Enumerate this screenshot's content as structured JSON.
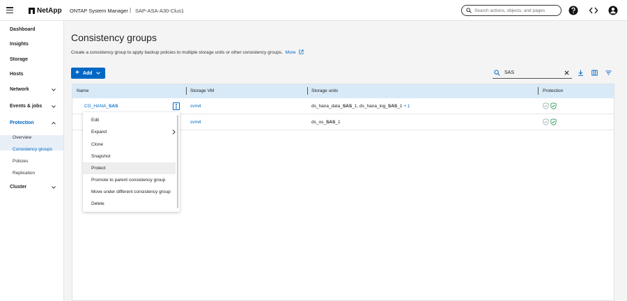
{
  "topbar": {
    "brand": "NetApp",
    "product": "ONTAP System Manager",
    "separator": "|",
    "cluster": "SAP-ASA-A30-Clus1",
    "search_placeholder": "Search actions, objects, and pages",
    "icons": [
      "menu-icon",
      "search-icon",
      "help-icon",
      "code-icon",
      "user-icon"
    ]
  },
  "sidebar": {
    "items": [
      {
        "label": "Dashboard"
      },
      {
        "label": "Insights"
      },
      {
        "label": "Storage"
      },
      {
        "label": "Hosts"
      },
      {
        "label": "Network"
      },
      {
        "label": "Events & jobs"
      },
      {
        "label": "Protection"
      },
      {
        "label": "Cluster"
      }
    ],
    "protection_sub": [
      {
        "label": "Overview"
      },
      {
        "label": "Consistency groups"
      },
      {
        "label": "Policies"
      },
      {
        "label": "Replication"
      }
    ]
  },
  "page": {
    "title": "Consistency groups",
    "description": "Create a consistency group to apply backup policies to multiple storage units or other consistency groups.",
    "more_link": "More"
  },
  "toolbar": {
    "add_label": "Add",
    "search_value": "SAS"
  },
  "table": {
    "columns": [
      "Name",
      "Storage VM",
      "Storage units",
      "Protection"
    ],
    "rows": [
      {
        "name_prefix": "CG_HANA_",
        "name_match": "SAS",
        "svm": "svm4",
        "units": [
          {
            "text": "ds_hana_data_",
            "bold": false
          },
          {
            "text": "SAS",
            "bold": true
          },
          {
            "text": "_1, ds_hana_log_",
            "bold": false
          },
          {
            "text": "SAS",
            "bold": true
          },
          {
            "text": "_1",
            "bold": false
          }
        ],
        "more": "+ 1"
      },
      {
        "name_prefix": "",
        "name_match": "",
        "svm": "svm4",
        "units": [
          {
            "text": "ds_os_",
            "bold": false
          },
          {
            "text": "SAS",
            "bold": true
          },
          {
            "text": "_1",
            "bold": false
          }
        ],
        "more": ""
      }
    ]
  },
  "context_menu": {
    "items": [
      {
        "label": "Edit"
      },
      {
        "label": "Expand"
      },
      {
        "label": "Clone"
      },
      {
        "label": "Snapshot"
      },
      {
        "label": "Protect"
      },
      {
        "label": "Promote to parent consistency group"
      },
      {
        "label": "Move under different consistency group"
      },
      {
        "label": "Delete"
      }
    ],
    "hovered": "Protect"
  },
  "colors": {
    "accent": "#0067c5",
    "header_bg": "#d8eaf8",
    "protection_green": "#2e9e5b"
  }
}
